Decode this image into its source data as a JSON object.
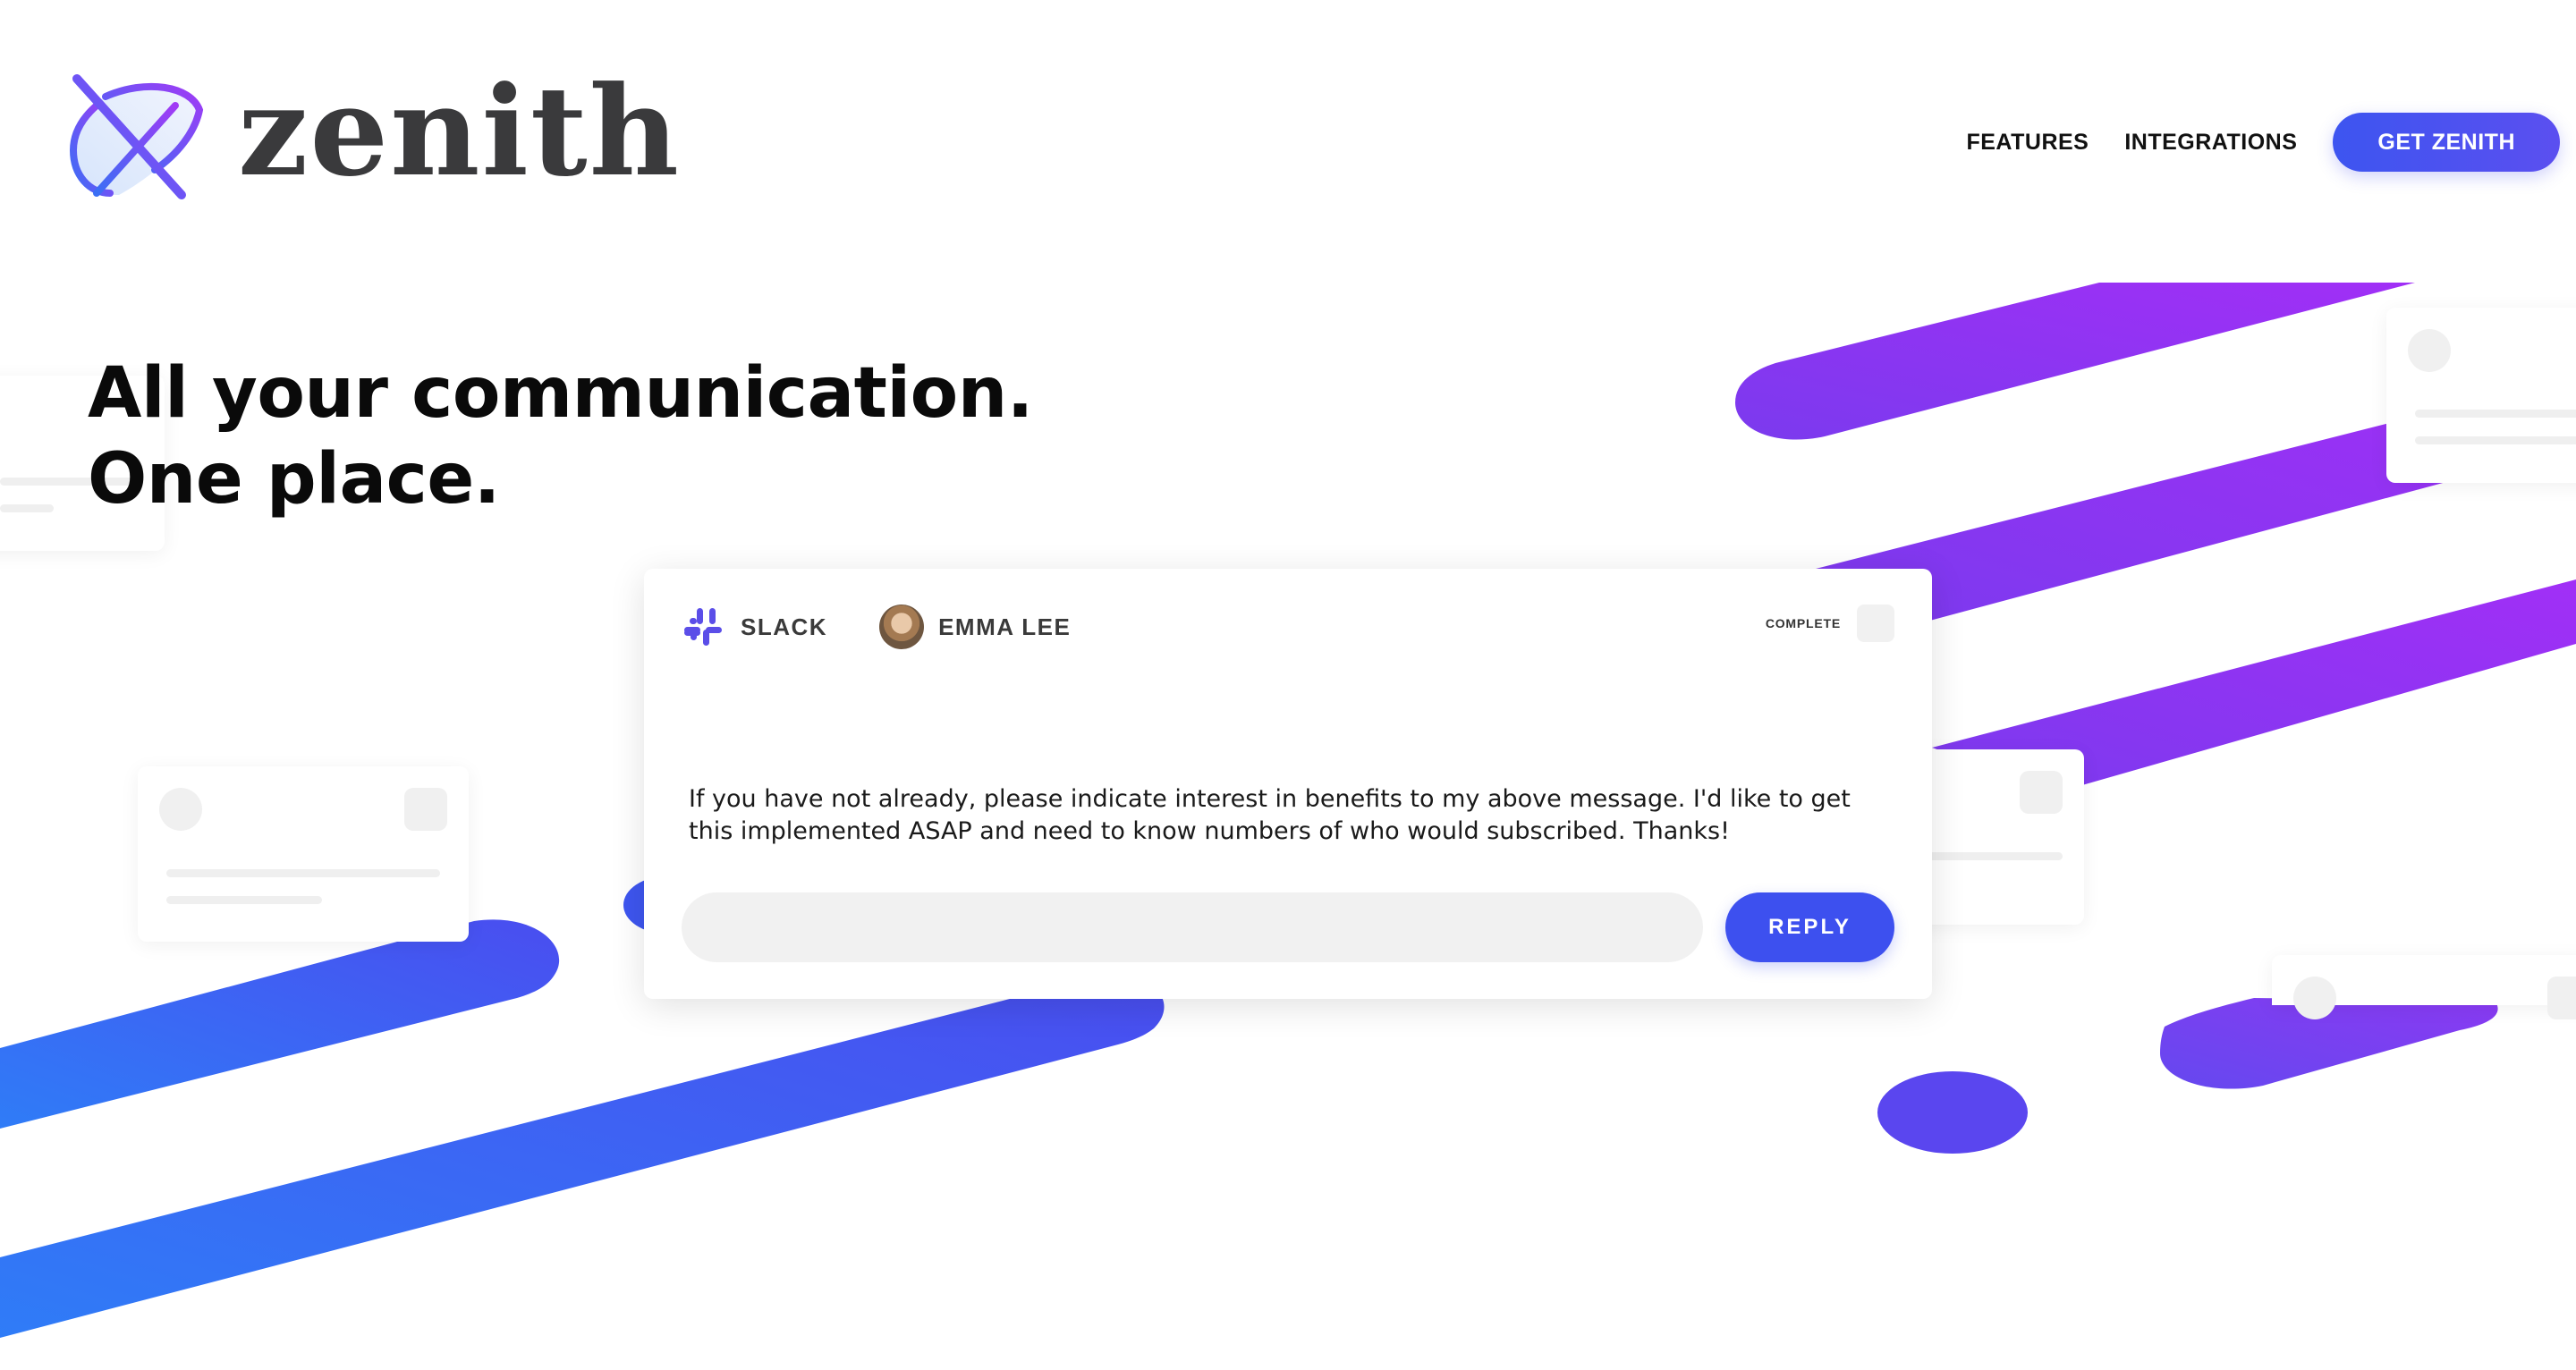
{
  "brand": {
    "name": "zenith",
    "logo_icon": "zenith-logo-icon",
    "colors": {
      "blue": "#3d55f0",
      "violet": "#6a45ee",
      "purple": "#9b30f5",
      "text_dark": "#0a0a0a"
    }
  },
  "nav": {
    "features_label": "FEATURES",
    "integrations_label": "INTEGRATIONS",
    "cta_label": "GET ZENITH"
  },
  "hero": {
    "title": "All your communication. One place."
  },
  "message_card": {
    "source_icon": "slack-icon",
    "source_label": "SLACK",
    "user_name": "EMMA LEE",
    "status_label": "COMPLETE",
    "message_text": "If you have not already, please indicate interest in benefits to my above message. I'd like to get this implemented ASAP and need to know numbers of who would subscribed. Thanks!",
    "reply_placeholder": "",
    "reply_label": "REPLY"
  }
}
